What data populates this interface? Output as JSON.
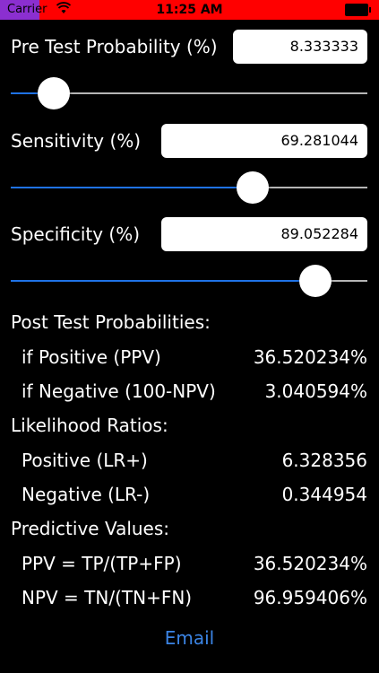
{
  "status_bar": {
    "carrier": "Carrier",
    "wifi_icon": "wifi-icon",
    "time": "11:25 AM",
    "battery_icon": "battery-icon",
    "colors": {
      "background": "#ff0000",
      "accent": "#8b2fd0"
    }
  },
  "inputs": {
    "pretest": {
      "label": "Pre Test Probability (%)",
      "value": "8.333333",
      "slider_level": 0.12
    },
    "sensitivity": {
      "label": "Sensitivity (%)",
      "value": "69.281044",
      "slider_level": 0.678
    },
    "specificity": {
      "label": "Specificity (%)",
      "value": "89.052284",
      "slider_level": 0.855
    }
  },
  "results": {
    "post_test": {
      "heading": "Post Test Probabilities:",
      "rows": [
        {
          "label": "if Positive (PPV)",
          "value": "36.520234%"
        },
        {
          "label": "if Negative (100-NPV)",
          "value": "3.040594%"
        }
      ]
    },
    "likelihood": {
      "heading": "Likelihood Ratios:",
      "rows": [
        {
          "label": "Positive (LR+)",
          "value": "6.328356"
        },
        {
          "label": "Negative (LR-)",
          "value": "0.344954"
        }
      ]
    },
    "predictive": {
      "heading": "Predictive Values:",
      "rows": [
        {
          "label": "PPV = TP/(TP+FP)",
          "value": "36.520234%"
        },
        {
          "label": "NPV = TN/(TN+FN)",
          "value": "96.959406%"
        }
      ]
    }
  },
  "email": {
    "label": "Email"
  },
  "colors": {
    "slider_fill": "#1f72e5",
    "slider_track": "#b5b5b5",
    "link": "#3b84e4"
  }
}
